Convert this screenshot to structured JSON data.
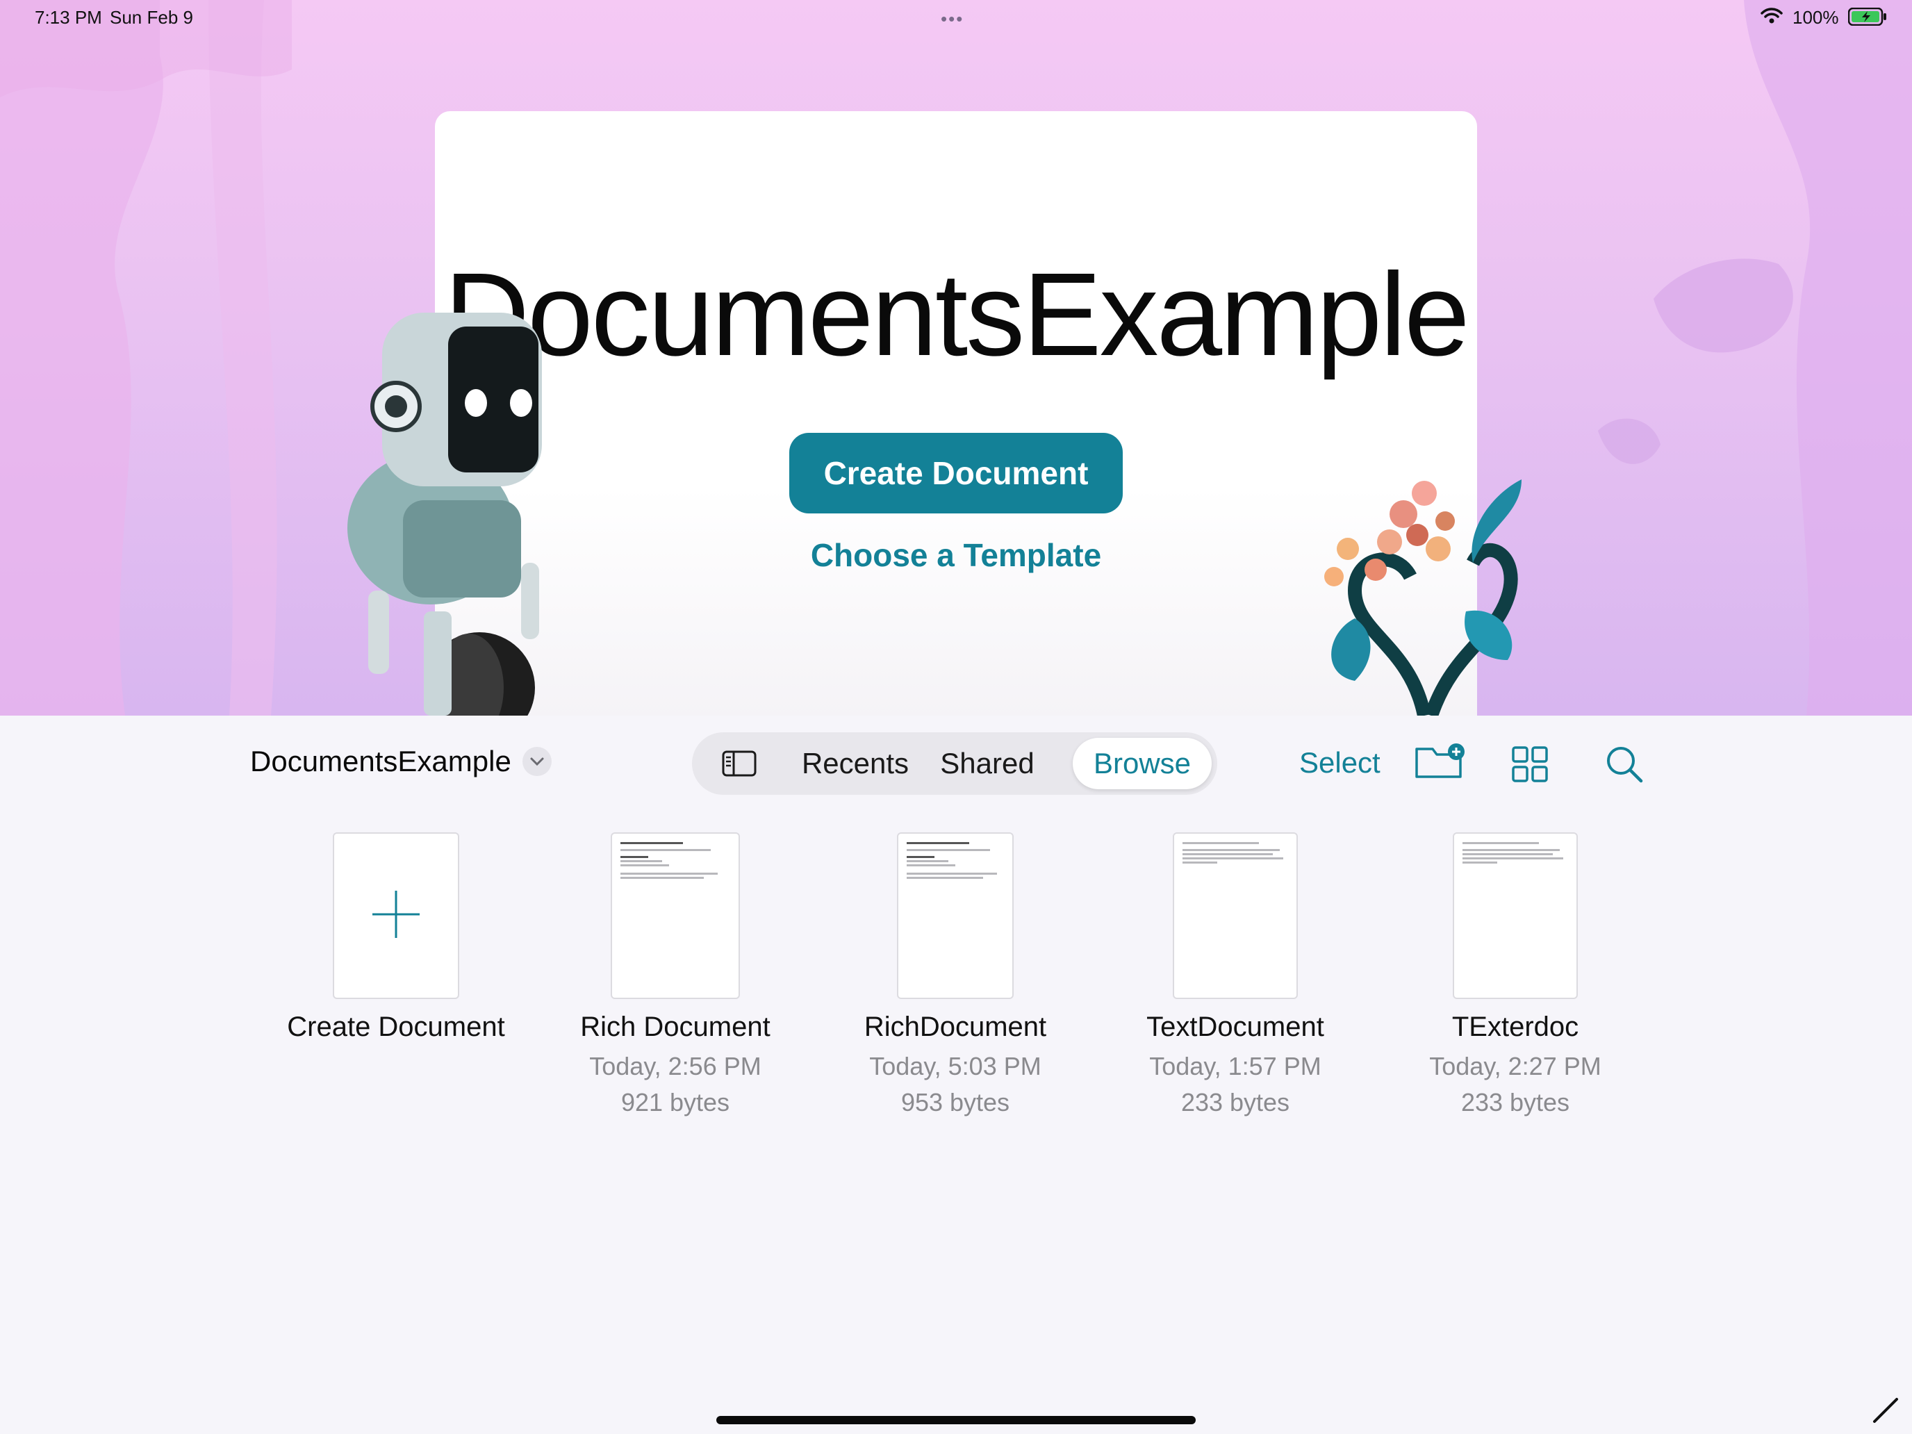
{
  "status_bar": {
    "time": "7:13 PM",
    "date": "Sun Feb 9",
    "multitask_dots": "•••",
    "battery_percent": "100%"
  },
  "hero": {
    "title": "DocumentsExample",
    "create_button": "Create Document",
    "template_link": "Choose a Template"
  },
  "toolbar": {
    "location_title": "DocumentsExample",
    "tabs": [
      {
        "label": "Recents"
      },
      {
        "label": "Shared"
      },
      {
        "label": "Browse"
      }
    ],
    "active_tab": "Browse",
    "select_label": "Select"
  },
  "documents": [
    {
      "name": "Create Document",
      "kind": "new"
    },
    {
      "name": "Rich Document",
      "date": "Today, 2:56 PM",
      "size": "921 bytes",
      "kind": "rich"
    },
    {
      "name": "RichDocument",
      "date": "Today, 5:03 PM",
      "size": "953 bytes",
      "kind": "rich"
    },
    {
      "name": "TextDocument",
      "date": "Today, 1:57 PM",
      "size": "233 bytes",
      "kind": "text"
    },
    {
      "name": "TExterdoc",
      "date": "Today, 2:27 PM",
      "size": "233 bytes",
      "kind": "text"
    }
  ],
  "colors": {
    "accent": "#138197",
    "hero_gradient_top": "#f5c9f4",
    "hero_gradient_bottom": "#d8b6f0",
    "background": "#f6f5fa"
  },
  "icons": [
    "wifi-icon",
    "battery-icon",
    "chevron-down-icon",
    "sidebar-icon",
    "new-folder-icon",
    "grid-view-icon",
    "search-icon",
    "plus-icon",
    "pencil-icon"
  ]
}
